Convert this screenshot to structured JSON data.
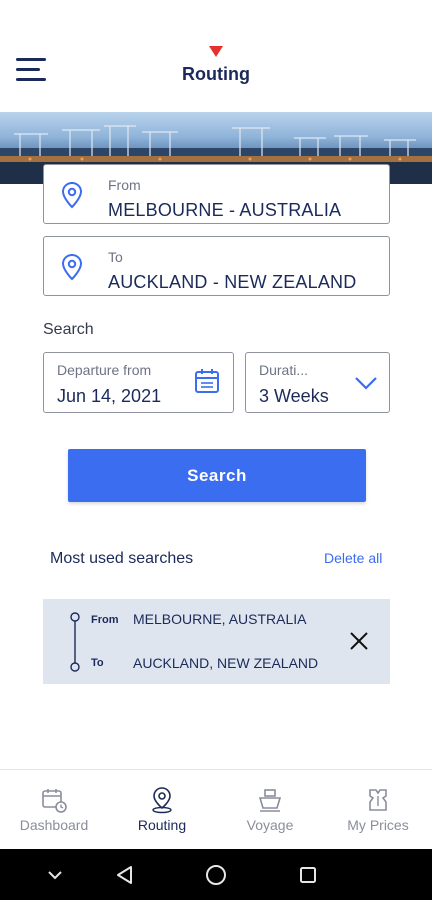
{
  "header": {
    "title": "Routing",
    "brand_color": "#e5302d",
    "menu_icon": "hamburger-menu-icon"
  },
  "route": {
    "from": {
      "label": "From",
      "value": "MELBOURNE - AUSTRALIA",
      "icon": "location-pin-icon"
    },
    "to": {
      "label": "To",
      "value": "AUCKLAND - NEW ZEALAND",
      "icon": "location-pin-icon"
    }
  },
  "search": {
    "section_label": "Search",
    "departure": {
      "label": "Departure from",
      "value": "Jun 14, 2021",
      "icon": "calendar-icon"
    },
    "duration": {
      "label": "Durati...",
      "value": "3 Weeks",
      "icon": "chevron-down-icon"
    },
    "button_label": "Search",
    "accent_color": "#3b6df0"
  },
  "most_used": {
    "title": "Most used searches",
    "delete_all_label": "Delete all",
    "items": [
      {
        "from_label": "From",
        "from_value": "MELBOURNE, AUSTRALIA",
        "to_label": "To",
        "to_value": "AUCKLAND, NEW ZEALAND"
      }
    ]
  },
  "bottom_nav": {
    "items": [
      {
        "label": "Dashboard",
        "icon": "dashboard-calendar-icon",
        "active": false
      },
      {
        "label": "Routing",
        "icon": "routing-pin-icon",
        "active": true
      },
      {
        "label": "Voyage",
        "icon": "ship-icon",
        "active": false
      },
      {
        "label": "My Prices",
        "icon": "price-tag-icon",
        "active": false
      }
    ]
  },
  "system_bar": {
    "buttons": [
      "chevron-down-icon",
      "back-icon",
      "home-icon",
      "recents-icon"
    ]
  }
}
